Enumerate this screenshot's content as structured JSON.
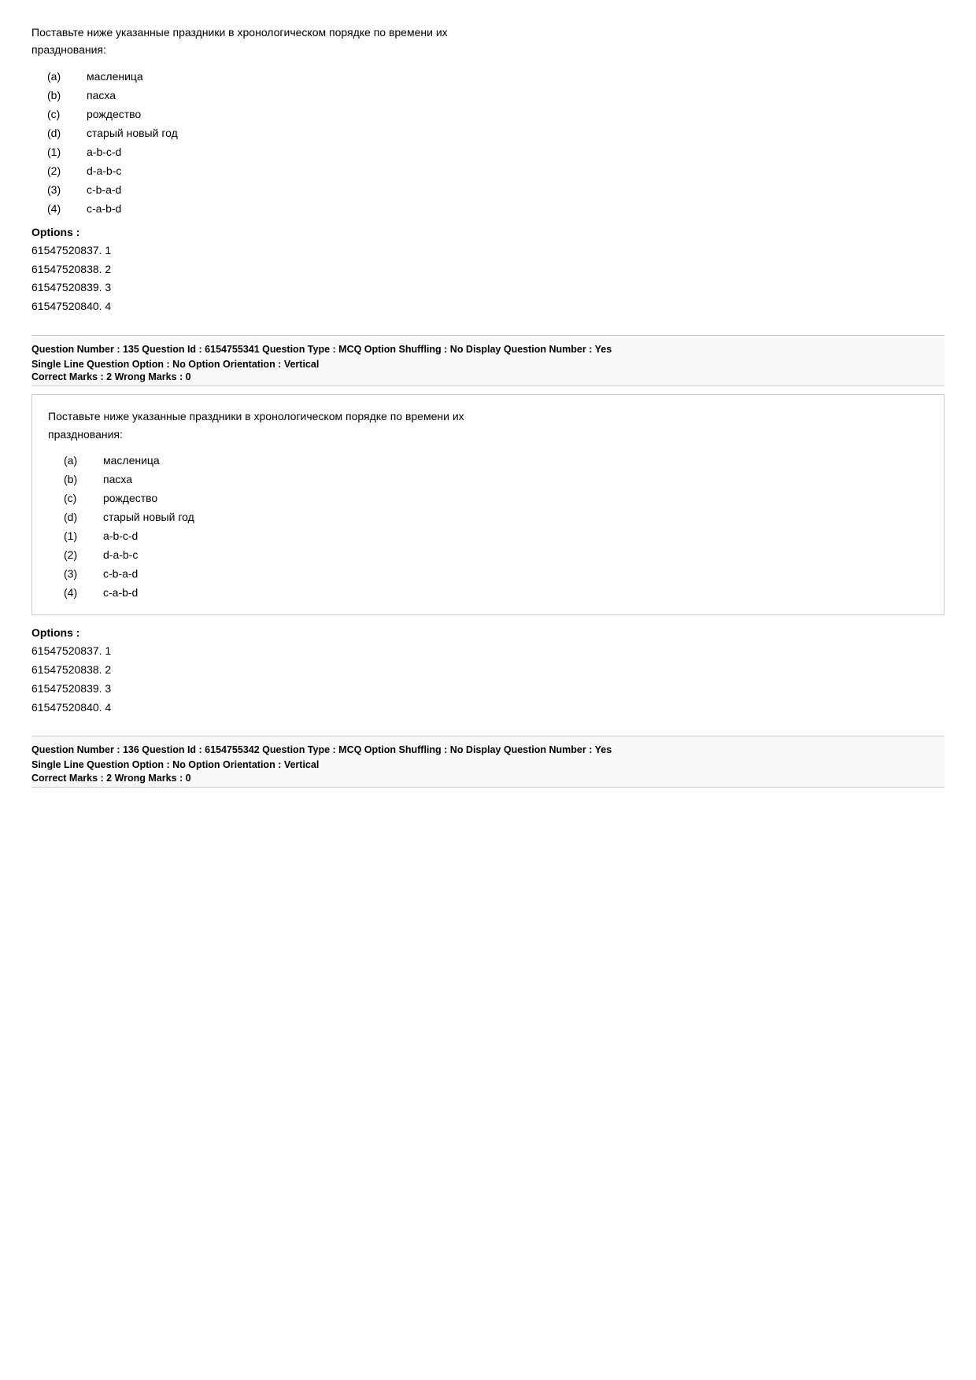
{
  "block1": {
    "question_text_line1": "Поставьте ниже указанные праздники в хронологическом порядке по времени их",
    "question_text_line2": "празднования:",
    "items": [
      {
        "label": "(a)",
        "text": "масленица"
      },
      {
        "label": "(b)",
        "text": "пасха"
      },
      {
        "label": "(c)",
        "text": "рождество"
      },
      {
        "label": "(d)",
        "text": "старый новый год"
      }
    ],
    "answers": [
      {
        "label": "(1)",
        "text": "a-b-c-d"
      },
      {
        "label": "(2)",
        "text": "d-a-b-c"
      },
      {
        "label": "(3)",
        "text": "c-b-a-d"
      },
      {
        "label": "(4)",
        "text": "c-a-b-d"
      }
    ],
    "options_title": "Options :",
    "options": [
      "61547520837.  1",
      "61547520838.  2",
      "61547520839.  3",
      "61547520840.  4"
    ]
  },
  "meta135": {
    "line1": "Question Number : 135  Question Id : 6154755341  Question Type : MCQ  Option Shuffling : No  Display Question Number : Yes",
    "line2": "Single Line Question Option : No  Option Orientation : Vertical",
    "marks": "Correct Marks : 2  Wrong Marks : 0"
  },
  "block2": {
    "question_text_line1": "Поставьте ниже указанные праздники в хронологическом порядке по времени их",
    "question_text_line2": "празднования:",
    "items": [
      {
        "label": "(a)",
        "text": "масленица"
      },
      {
        "label": "(b)",
        "text": "пасха"
      },
      {
        "label": "(c)",
        "text": "рождество"
      },
      {
        "label": "(d)",
        "text": "старый новый год"
      }
    ],
    "answers": [
      {
        "label": "(1)",
        "text": "a-b-c-d"
      },
      {
        "label": "(2)",
        "text": "d-a-b-c"
      },
      {
        "label": "(3)",
        "text": "c-b-a-d"
      },
      {
        "label": "(4)",
        "text": "c-a-b-d"
      }
    ],
    "options_title": "Options :",
    "options": [
      "61547520837.  1",
      "61547520838.  2",
      "61547520839.  3",
      "61547520840.  4"
    ]
  },
  "meta136": {
    "line1": "Question Number : 136  Question Id : 6154755342  Question Type : MCQ  Option Shuffling : No  Display Question Number : Yes",
    "line2": "Single Line Question Option : No  Option Orientation : Vertical",
    "marks": "Correct Marks : 2  Wrong Marks : 0"
  }
}
